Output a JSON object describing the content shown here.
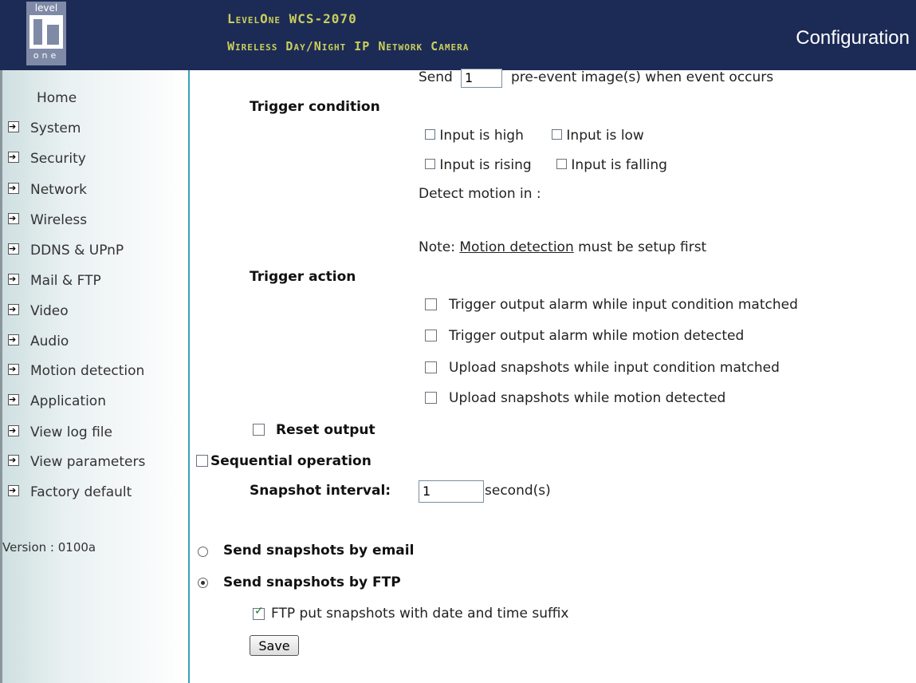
{
  "header": {
    "logo_top": "level",
    "logo_bottom": "one",
    "product": "LevelOne WCS-2070",
    "subtitle": "Wireless Day/Night IP Network Camera",
    "page_title": "Configuration"
  },
  "sidebar": {
    "home": "Home",
    "items": [
      {
        "label": "System"
      },
      {
        "label": "Security"
      },
      {
        "label": "Network"
      },
      {
        "label": "Wireless"
      },
      {
        "label": "DDNS & UPnP"
      },
      {
        "label": "Mail & FTP"
      },
      {
        "label": "Video"
      },
      {
        "label": "Audio"
      },
      {
        "label": "Motion detection"
      },
      {
        "label": "Application"
      },
      {
        "label": "View log file"
      },
      {
        "label": "View parameters"
      },
      {
        "label": "Factory default"
      }
    ],
    "version": "Version : 0100a"
  },
  "main": {
    "pre_event": {
      "send_label": "Send",
      "value": "1",
      "suffix": "pre-event image(s) when event occurs"
    },
    "trigger_condition": {
      "heading": "Trigger condition",
      "input_high": "Input is high",
      "input_low": "Input is low",
      "input_rising": "Input is rising",
      "input_falling": "Input is falling",
      "detect_motion": "Detect motion in :",
      "note_prefix": "Note:",
      "note_link": "Motion detection",
      "note_suffix": "must be setup first"
    },
    "trigger_action": {
      "heading": "Trigger action",
      "options": [
        "Trigger output alarm while input condition matched",
        "Trigger output alarm while motion detected",
        "Upload snapshots while input condition matched",
        "Upload snapshots while motion detected"
      ]
    },
    "reset_output": "Reset output",
    "sequential_operation": "Sequential operation",
    "snapshot_interval": {
      "label": "Snapshot interval:",
      "value": "1",
      "unit": "second(s)"
    },
    "send_email": "Send snapshots by email",
    "send_ftp": "Send snapshots by FTP",
    "ftp_suffix": "FTP put snapshots with date and time suffix",
    "save_label": "Save"
  },
  "colors": {
    "header_bg": "#1c2b55",
    "header_text": "#c9ce5c",
    "divider": "#3aa0b8"
  }
}
